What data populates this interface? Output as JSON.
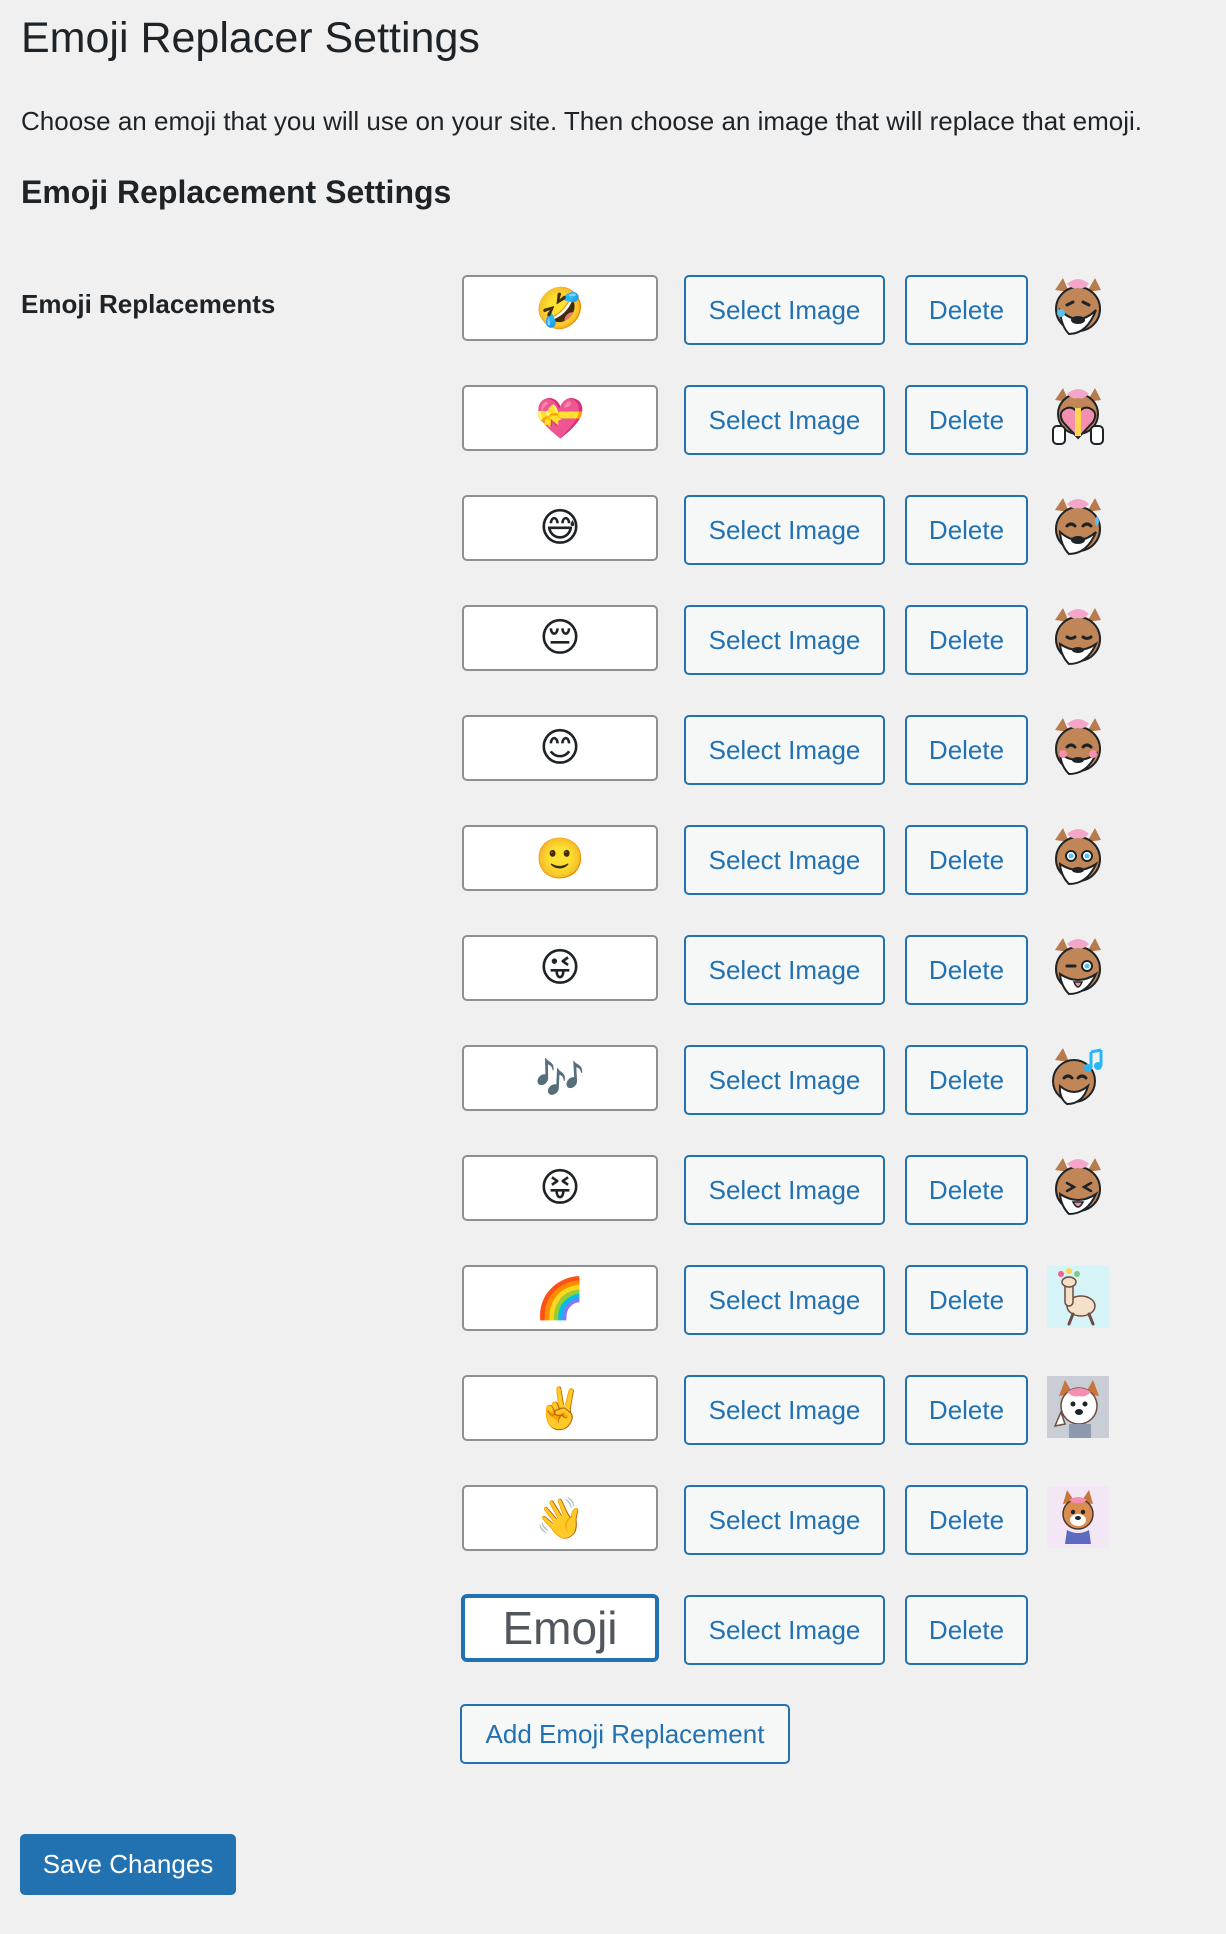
{
  "page": {
    "title": "Emoji Replacer Settings",
    "intro": "Choose an emoji that you will use on your site. Then choose an image that will replace that emoji.",
    "section_title": "Emoji Replacement Settings",
    "field_label": "Emoji Replacements"
  },
  "replacements": [
    {
      "emoji": "🤣",
      "select_label": "Select Image",
      "delete_label": "Delete",
      "has_image": true,
      "image_icon": "fox-crying-laughing-sticker"
    },
    {
      "emoji": "💝",
      "select_label": "Select Image",
      "delete_label": "Delete",
      "has_image": true,
      "image_icon": "fox-holding-heart-sticker"
    },
    {
      "emoji": "😅",
      "select_label": "Select Image",
      "delete_label": "Delete",
      "has_image": true,
      "image_icon": "fox-sweat-smile-sticker"
    },
    {
      "emoji": "😔",
      "select_label": "Select Image",
      "delete_label": "Delete",
      "has_image": true,
      "image_icon": "fox-pensive-sticker"
    },
    {
      "emoji": "😊",
      "select_label": "Select Image",
      "delete_label": "Delete",
      "has_image": true,
      "image_icon": "fox-blush-sticker"
    },
    {
      "emoji": "🙂",
      "select_label": "Select Image",
      "delete_label": "Delete",
      "has_image": true,
      "image_icon": "fox-smile-sticker"
    },
    {
      "emoji": "😜",
      "select_label": "Select Image",
      "delete_label": "Delete",
      "has_image": true,
      "image_icon": "fox-wink-tongue-sticker"
    },
    {
      "emoji": "🎶",
      "select_label": "Select Image",
      "delete_label": "Delete",
      "has_image": true,
      "image_icon": "fox-music-notes-sticker"
    },
    {
      "emoji": "😝",
      "select_label": "Select Image",
      "delete_label": "Delete",
      "has_image": true,
      "image_icon": "fox-squint-tongue-sticker"
    },
    {
      "emoji": "🌈",
      "select_label": "Select Image",
      "delete_label": "Delete",
      "has_image": true,
      "image_icon": "dancing-llama-image"
    },
    {
      "emoji": "✌️",
      "select_label": "Select Image",
      "delete_label": "Delete",
      "has_image": true,
      "image_icon": "dog-peace-sign-image"
    },
    {
      "emoji": "👋",
      "select_label": "Select Image",
      "delete_label": "Delete",
      "has_image": true,
      "image_icon": "dog-waving-image"
    },
    {
      "emoji": "",
      "placeholder": "Emoji",
      "select_label": "Select Image",
      "delete_label": "Delete",
      "has_image": false
    }
  ],
  "actions": {
    "add_label": "Add Emoji Replacement",
    "save_label": "Save Changes"
  },
  "colors": {
    "background": "#f0f0f1",
    "accent": "#2271b1",
    "text": "#1d2327",
    "input_border": "#8c8f94"
  }
}
